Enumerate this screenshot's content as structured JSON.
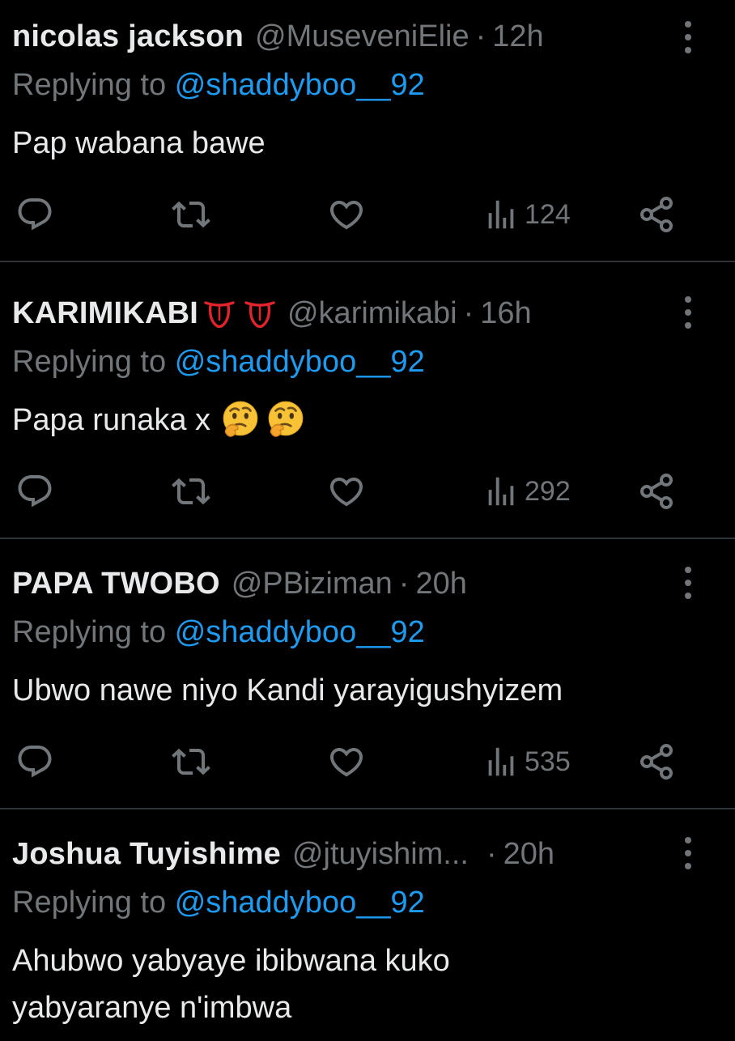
{
  "colors": {
    "background": "#000000",
    "text": "#e7e9ea",
    "muted": "#71767b",
    "link": "#1d9bf0",
    "divider": "#2f3336"
  },
  "icons": [
    "more-vertical-icon",
    "reply-icon",
    "retweet-icon",
    "like-icon",
    "views-icon",
    "share-icon",
    "thinking-face-emoji",
    "red-tongue-emoji"
  ],
  "tweets": [
    {
      "name": "nicolas jackson",
      "handle": "@MuseveniElie",
      "sep": "·",
      "time": "12h",
      "reply_prefix": "Replying to",
      "reply_to": "@shaddyboo__92",
      "text": "Pap wabana bawe",
      "views": "124"
    },
    {
      "name": "KARIMIKABI",
      "handle": "@karimikabi",
      "sep": "·",
      "time": "16h",
      "reply_prefix": "Replying to",
      "reply_to": "@shaddyboo__92",
      "text": "Papa runaka x",
      "views": "292"
    },
    {
      "name": "PAPA TWOBO",
      "handle": "@PBiziman",
      "sep": "·",
      "time": "20h",
      "reply_prefix": "Replying to",
      "reply_to": "@shaddyboo__92",
      "text": "Ubwo nawe niyo Kandi yarayigushyizem",
      "views": "535"
    },
    {
      "name": "Joshua Tuyishime",
      "handle": "@jtuyishim...",
      "sep": "·",
      "time": "20h",
      "reply_prefix": "Replying to",
      "reply_to": "@shaddyboo__92",
      "text_line1": "Ahubwo yabyaye ibibwana kuko",
      "text_line2": "yabyaranye n'imbwa"
    }
  ]
}
